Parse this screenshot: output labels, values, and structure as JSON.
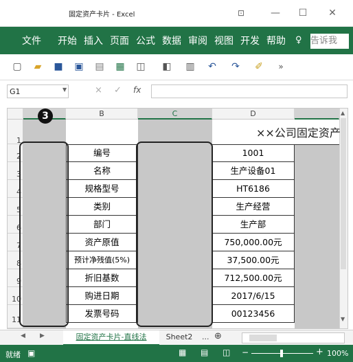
{
  "window": {
    "title": "固定资产卡片 - Excel"
  },
  "ribbon": {
    "tabs": [
      "文件",
      "开始",
      "插入",
      "页面",
      "公式",
      "数据",
      "审阅",
      "视图",
      "开发",
      "帮助"
    ],
    "tell_me": "告诉我"
  },
  "formula_bar": {
    "name_box": "G1",
    "fx": "fx",
    "cancel": "×",
    "enter": "✓"
  },
  "columns": [
    "B",
    "C",
    "D"
  ],
  "rows": [
    "1",
    "2",
    "3",
    "4",
    "5",
    "6",
    "7",
    "8",
    "9",
    "10",
    "11"
  ],
  "sheet": {
    "title": "××公司固定资产",
    "labels": [
      "编号",
      "名称",
      "规格型号",
      "类别",
      "部门",
      "资产原值",
      "预计净残值(5%)",
      "折旧基数",
      "购进日期",
      "发票号码"
    ],
    "values": [
      "1001",
      "生产设备01",
      "HT6186",
      "生产经营",
      "生产部",
      "750,000.00元",
      "37,500.00元",
      "712,500.00元",
      "2017/6/15",
      "00123456"
    ]
  },
  "badge": "3",
  "sheet_tabs": {
    "active": "固定资产卡片-直线法",
    "other": "Sheet2",
    "more": "..."
  },
  "status": {
    "mode": "就绪",
    "zoom": "100%"
  },
  "colors": {
    "accent": "#217346"
  }
}
